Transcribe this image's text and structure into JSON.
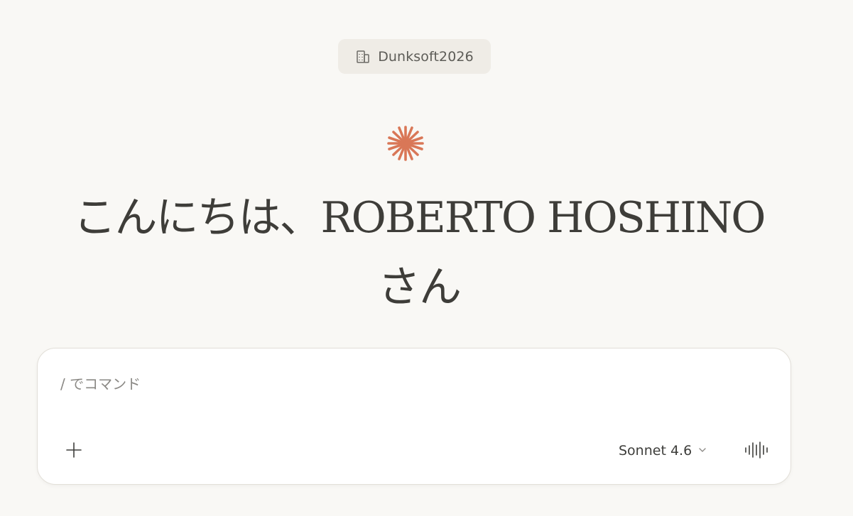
{
  "org": {
    "name": "Dunksoft2026",
    "icon": "building-icon"
  },
  "logo": {
    "icon": "spark-icon",
    "color": "#d97757"
  },
  "greeting": {
    "text": "こんにちは、ROBERTO HOSHINO\nさん"
  },
  "composer": {
    "placeholder": "/ でコマンド",
    "value": "",
    "add_icon": "plus-icon",
    "model_label": "Sonnet 4.6",
    "model_icon": "chevron-down-icon",
    "voice_icon": "voice-waveform-icon"
  }
}
